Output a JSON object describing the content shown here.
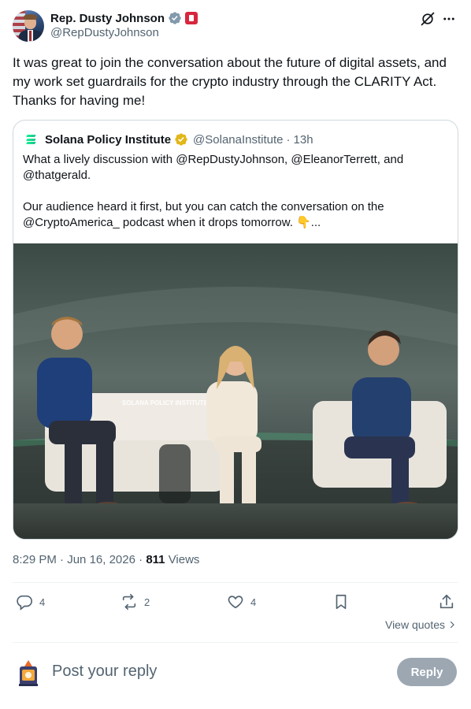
{
  "author": {
    "display_name": "Rep. Dusty Johnson",
    "handle": "@RepDustyJohnson",
    "avatar_icon": "user-avatar-portrait",
    "verified_badge_color": "#829aab",
    "gov_badge_color": "#d7263d"
  },
  "post": {
    "text": "It was great to join the conversation about the future of digital assets, and my work set guardrails for the crypto industry through the CLARITY Act. Thanks for having me!",
    "time": "8:29 PM",
    "date": "Jun 16, 2026",
    "views_count": "811",
    "views_label": "Views"
  },
  "quoted": {
    "display_name": "Solana Policy Institute",
    "handle": "@SolanaInstitute",
    "time_ago": "13h",
    "verified_badge_color": "#e2b719",
    "text_line1": "What a lively discussion with @RepDustyJohnson, @EleanorTerrett, and @thatgerald.",
    "text_line2": "Our audience heard it first, but you can catch the conversation on the @CryptoAmerica_ podcast when it drops tomorrow. 👇...",
    "photo_text": "SOLANA POLICY INSTITUTE"
  },
  "actions": {
    "replies": "4",
    "reposts": "2",
    "likes": "4",
    "accent_color": "#536471"
  },
  "view_quotes_label": "View quotes",
  "reply_box": {
    "placeholder": "Post your reply",
    "button_label": "Reply"
  }
}
